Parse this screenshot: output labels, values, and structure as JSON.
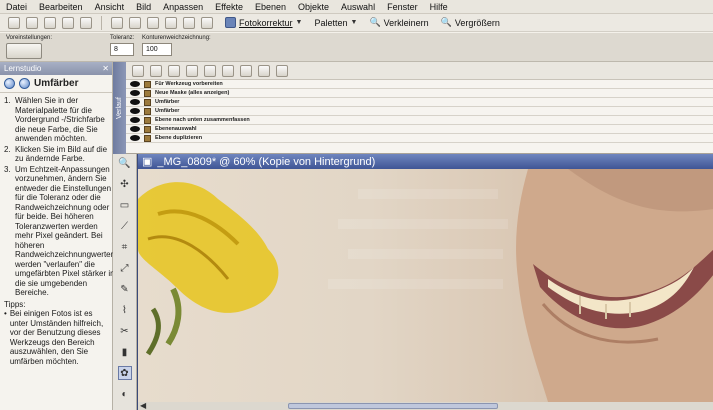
{
  "menubar": {
    "items": [
      "Datei",
      "Bearbeiten",
      "Ansicht",
      "Bild",
      "Anpassen",
      "Effekte",
      "Ebenen",
      "Objekte",
      "Auswahl",
      "Fenster",
      "Hilfe"
    ]
  },
  "toolbar": {
    "fotokorrektur": "Fotokorrektur",
    "paletten": "Paletten",
    "verkleinern": "Verkleinern",
    "vergroessern": "Vergrößern"
  },
  "options": {
    "voreinstellungen_label": "Voreinstellungen:",
    "toleranz_label": "Toleranz:",
    "toleranz_value": "8",
    "kontur_label": "Konturenweichzeichnung:",
    "kontur_value": "100"
  },
  "dock": {
    "header": "Lernstudio",
    "title": "Umfärber",
    "steps": [
      {
        "num": "1.",
        "text": "Wählen Sie in der Materialpalette für die Vordergrund -/Strichfarbe die neue Farbe, die Sie anwenden möchten."
      },
      {
        "num": "2.",
        "text": "Klicken Sie im Bild auf die zu ändernde Farbe."
      },
      {
        "num": "3.",
        "text": "Um Echtzeit-Anpassungen vorzunehmen, ändern Sie entweder die Einstellungen für die Toleranz oder die Randweichzeichnung oder für beide. Bei höheren Toleranzwerten werden mehr Pixel geändert. Bei höheren Randweichzeichnungwerten werden \"verlaufen\" die umgefärbten Pixel stärker in die sie umgebenden Bereiche."
      }
    ],
    "tips_label": "Tipps:",
    "tip": "Bei einigen Fotos ist es unter Umständen hilfreich, vor der Benutzung dieses Werkzeugs den Bereich auszuwählen, den Sie umfärben möchten."
  },
  "history": {
    "tab_label": "Verlauf",
    "rows": [
      "Für Werkzeug vorbereiten",
      "Neue Maske (alles anzeigen)",
      "Umfärber",
      "Umfärber",
      "Ebene nach unten zusammenfassen",
      "Ebenenauswahl",
      "Ebene duplizieren"
    ]
  },
  "document": {
    "title": "_MG_0809* @ 60% (Kopie von Hintergrund)"
  },
  "colors": {
    "title_bar": "#3f5595",
    "accent": "#6a7aa5"
  }
}
